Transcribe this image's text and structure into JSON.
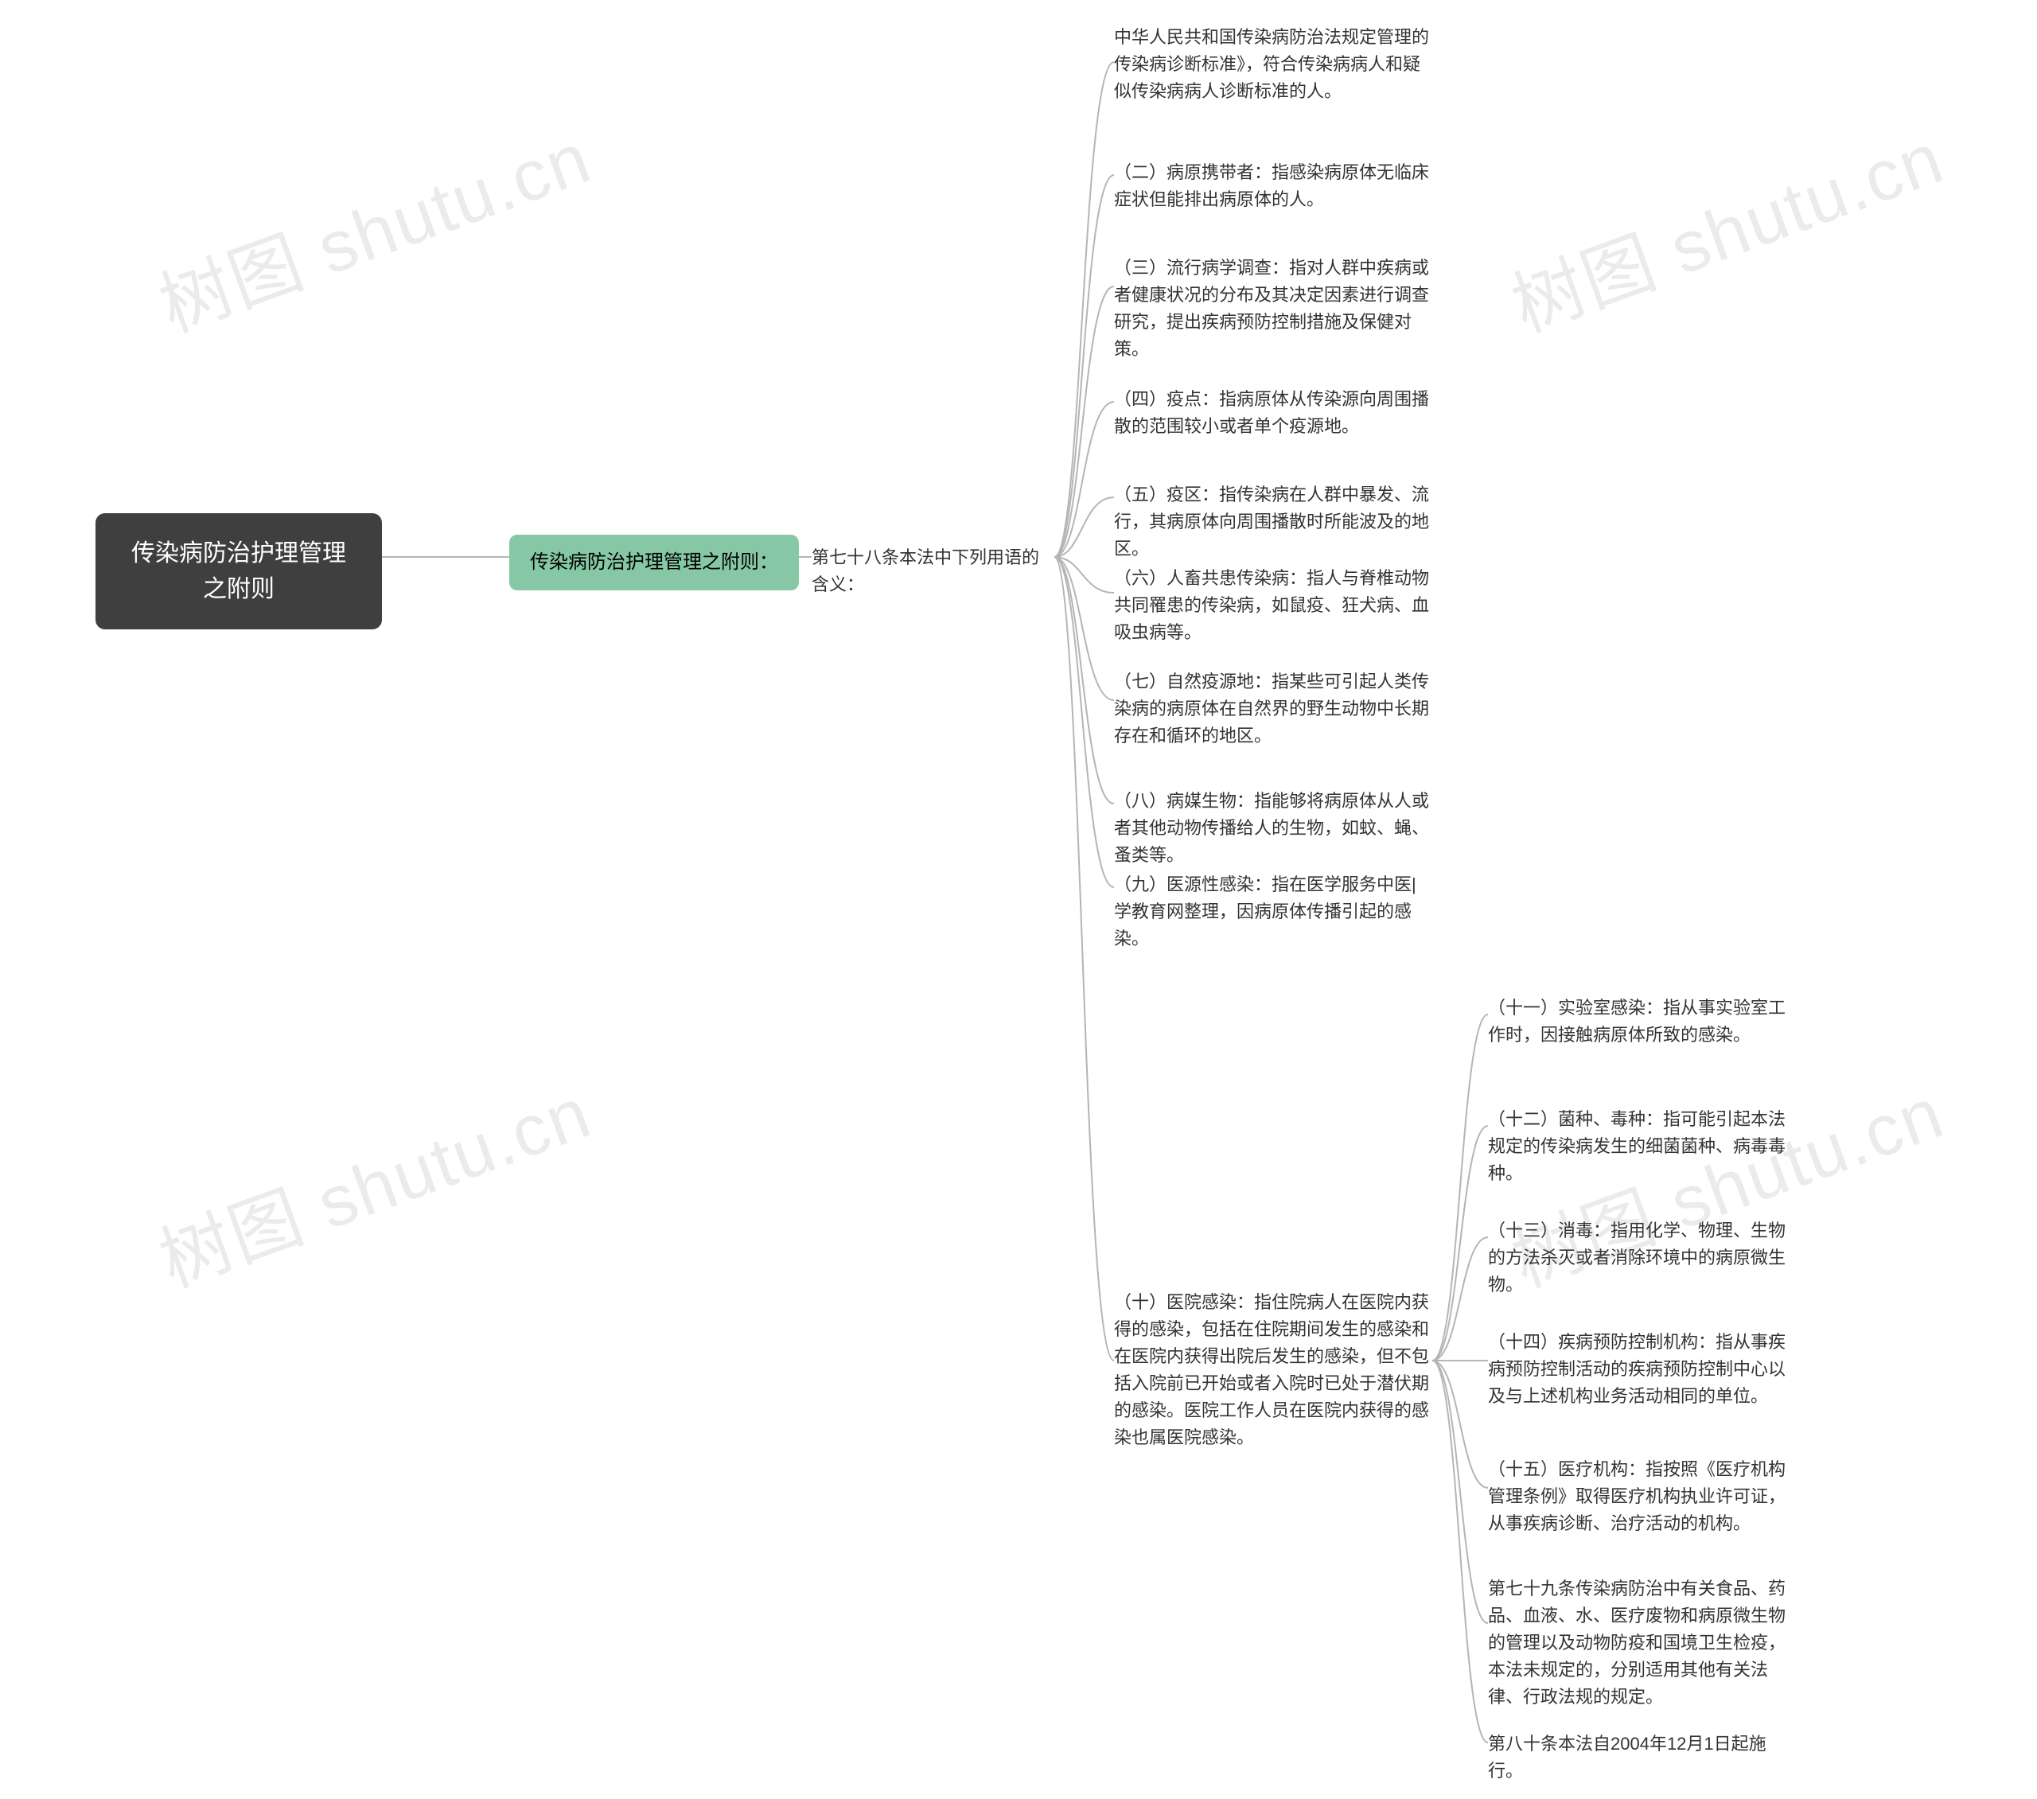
{
  "watermark": "树图 shutu.cn",
  "root": "传染病防治护理管理之附则",
  "level1": "传染病防治护理管理之附则：",
  "level2": "第七十八条本法中下列用语的含义：",
  "items_a": [
    "中华人民共和国传染病防治法规定管理的传染病诊断标准》，符合传染病病人和疑似传染病病人诊断标准的人。",
    "（二）病原携带者：指感染病原体无临床症状但能排出病原体的人。",
    "（三）流行病学调查：指对人群中疾病或者健康状况的分布及其决定因素进行调查研究，提出疾病预防控制措施及保健对策。",
    "（四）疫点：指病原体从传染源向周围播散的范围较小或者单个疫源地。",
    "（五）疫区：指传染病在人群中暴发、流行，其病原体向周围播散时所能波及的地区。",
    "（六）人畜共患传染病：指人与脊椎动物共同罹患的传染病，如鼠疫、狂犬病、血吸虫病等。",
    "（七）自然疫源地：指某些可引起人类传染病的病原体在自然界的野生动物中长期存在和循环的地区。",
    "（八）病媒生物：指能够将病原体从人或者其他动物传播给人的生物，如蚊、蝇、蚤类等。",
    "（九）医源性感染：指在医学服务中医|学教育网整理，因病原体传播引起的感染。"
  ],
  "item_ten": "（十）医院感染：指住院病人在医院内获得的感染，包括在住院期间发生的感染和在医院内获得出院后发生的感染，但不包括入院前已开始或者入院时已处于潜伏期的感染。医院工作人员在医院内获得的感染也属医院感染。",
  "items_b": [
    "（十一）实验室感染：指从事实验室工作时，因接触病原体所致的感染。",
    "（十二）菌种、毒种：指可能引起本法规定的传染病发生的细菌菌种、病毒毒种。",
    "（十三）消毒：指用化学、物理、生物的方法杀灭或者消除环境中的病原微生物。",
    "（十四）疾病预防控制机构：指从事疾病预防控制活动的疾病预防控制中心以及与上述机构业务活动相同的单位。",
    "（十五）医疗机构：指按照《医疗机构管理条例》取得医疗机构执业许可证，从事疾病诊断、治疗活动的机构。",
    "第七十九条传染病防治中有关食品、药品、血液、水、医疗废物和病原微生物的管理以及动物防疫和国境卫生检疫，本法未规定的，分别适用其他有关法律、行政法规的规定。",
    "第八十条本法自2004年12月1日起施行。"
  ],
  "colors": {
    "root_bg": "#3f3f3f",
    "green_bg": "#86c8a5",
    "line": "#b5b5b5"
  }
}
